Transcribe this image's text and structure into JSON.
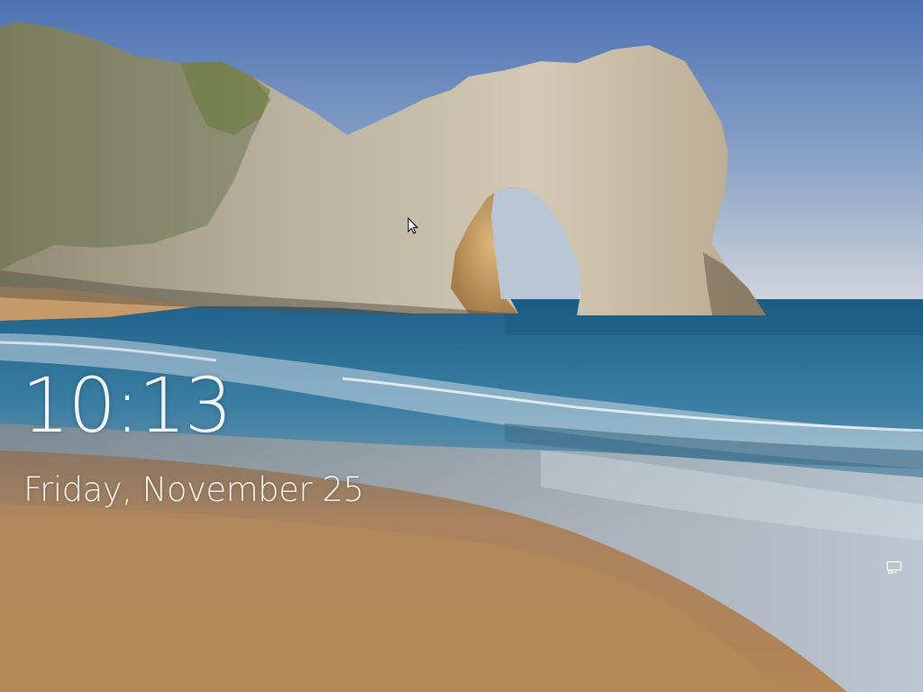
{
  "lock_screen": {
    "time": "10:13",
    "date": "Friday, November 25",
    "network_icon": "network-ethernet-icon",
    "cursor_icon": "mouse-pointer-icon"
  },
  "colors": {
    "sky_top": "#4f73b4",
    "sky_horizon": "#c9d2dd",
    "sea": "#2a6f96",
    "sand": "#b98a5e",
    "cliff": "#c9bfae",
    "text": "#ffffff"
  }
}
